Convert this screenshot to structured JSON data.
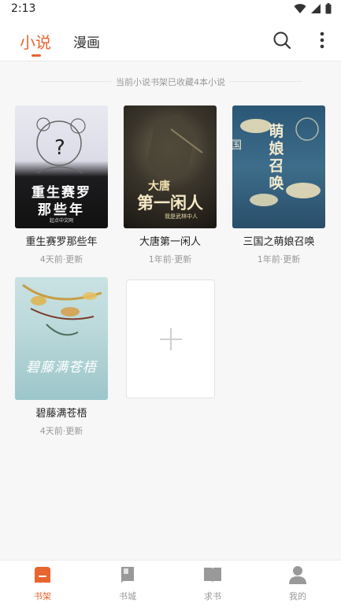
{
  "status_bar": {
    "time": "2:13"
  },
  "header": {
    "tabs": [
      {
        "label": "小说",
        "active": true
      },
      {
        "label": "漫画",
        "active": false
      }
    ]
  },
  "shelf_info": "当前小说书架已收藏4本小说",
  "books": [
    {
      "title": "重生赛罗那些年",
      "update": "4天前·更新",
      "cover_text": "重生赛罗",
      "cover_text2": "那些年",
      "cover_badge": "起点中文网"
    },
    {
      "title": "大唐第一闲人",
      "update": "1年前·更新",
      "cover_text": "大唐",
      "cover_text2": "第一闲人",
      "cover_badge": "我是武林中人"
    },
    {
      "title": "三国之萌娘召唤",
      "update": "1年前·更新",
      "cover_text": "萌娘召唤",
      "cover_text2": "三国"
    },
    {
      "title": "碧藤满苍梧",
      "update": "4天前·更新",
      "cover_text": "碧藤满苍梧"
    }
  ],
  "bottom_nav": [
    {
      "label": "书架",
      "icon": "bookshelf-icon",
      "active": true
    },
    {
      "label": "书城",
      "icon": "book-icon",
      "active": false
    },
    {
      "label": "求书",
      "icon": "open-book-icon",
      "active": false
    },
    {
      "label": "我的",
      "icon": "user-icon",
      "active": false
    }
  ],
  "colors": {
    "accent": "#e9652f",
    "inactive": "#999999"
  }
}
